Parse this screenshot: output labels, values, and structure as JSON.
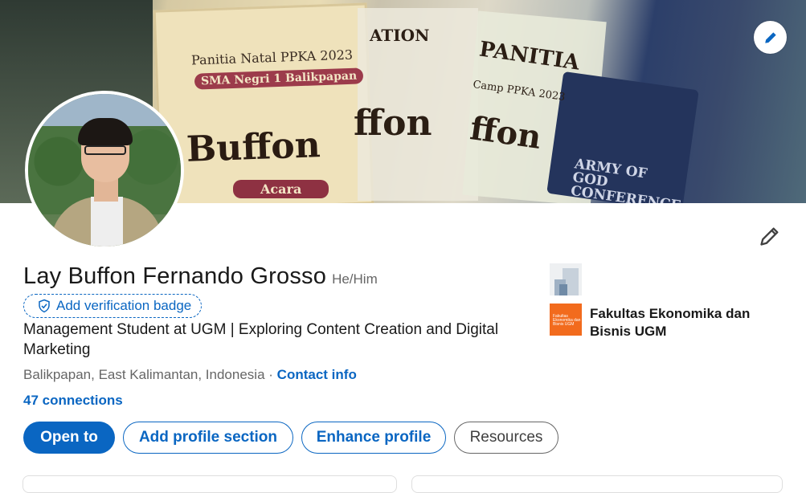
{
  "cover": {
    "texts": {
      "panitia": "Panitia Natal PPKA 2023",
      "school": "SMA Negri 1 Balikpapan",
      "buffon": "Buffon",
      "acara": "Acara",
      "ation": "ATION",
      "ffon": "ffon",
      "panitia2": "PANITIA",
      "camp": "Camp PPKA 2023",
      "ffon2": "ffon",
      "army": "ARMY OF GOD CONFERENCE"
    },
    "edit_icon": "pencil-icon"
  },
  "profile": {
    "name": "Lay Buffon Fernando Grosso",
    "pronouns": "He/Him",
    "verification_label": "Add verification badge",
    "headline": "Management Student at UGM | Exploring Content Creation and Digital Marketing",
    "location": "Balikpapan, East Kalimantan, Indonesia",
    "separator": "·",
    "contact_info": "Contact info",
    "connections": "47 connections",
    "edit_icon": "pencil-icon"
  },
  "actions": {
    "open_to": "Open to",
    "add_profile_section": "Add profile section",
    "enhance_profile": "Enhance profile",
    "resources": "Resources"
  },
  "education": {
    "school_name": "Fakultas Ekonomika dan Bisnis UGM",
    "logo_text": "Fakultas Ekonomika dan Bisnis UGM"
  },
  "colors": {
    "accent": "#0a66c2",
    "text": "#191919",
    "muted": "#666666"
  }
}
